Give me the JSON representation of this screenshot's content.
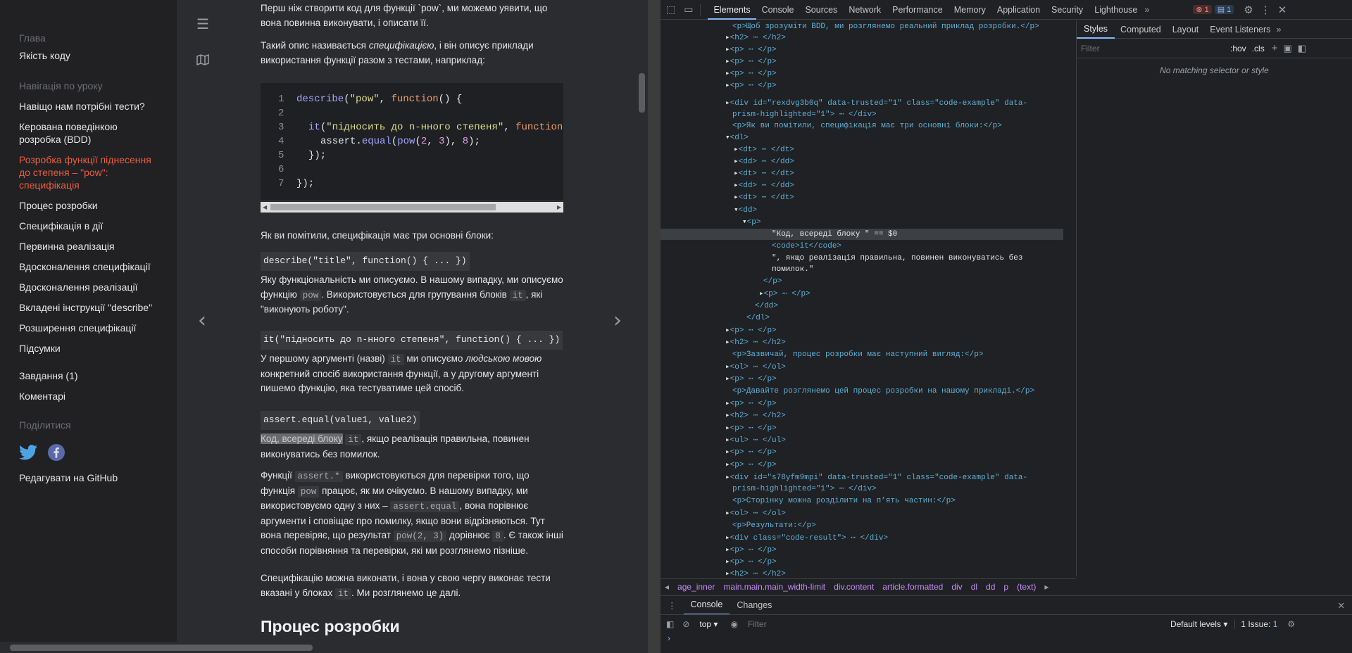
{
  "sidebar": {
    "chapter_head": "Глава",
    "chapter_link": "Якість коду",
    "nav_head": "Навігація по уроку",
    "nav_items": [
      "Навіщо нам потрібні тести?",
      "Керована поведінкою розробка (BDD)",
      "Розробка функції піднесення до степеня – \"pow\": специфікація",
      "Процес розробки",
      "Специфікація в дії",
      "Первинна реалізація",
      "Вдосконалення специфікації",
      "Вдосконалення реалізації",
      "Вкладені інструкції \"describe\"",
      "Розширення специфікації",
      "Підсумки"
    ],
    "tasks": "Завдання (1)",
    "comments": "Коментарі",
    "share_head": "Поділитися",
    "edit": "Редагувати на GitHub"
  },
  "content": {
    "p1": "Перш ніж створити код для функції `pow`, ми можемо уявити, що вона повинна виконувати, і описати її.",
    "p2a": "Такий опис називається ",
    "p2b": "специфікацією",
    "p2c": ", і він описує приклади використання функції разом з тестами, наприклад:",
    "code_lines": [
      "1",
      "2",
      "3",
      "4",
      "5",
      "6",
      "7"
    ],
    "code_l1a": "describe",
    "code_l1b": "(",
    "code_l1c": "\"pow\"",
    "code_l1d": ", ",
    "code_l1e": "function",
    "code_l1f": "() {",
    "code_l3a": "it",
    "code_l3b": "(",
    "code_l3c": "\"підносить до n-нного степеня\"",
    "code_l3d": ", ",
    "code_l3e": "function(",
    "code_l4a": "assert.",
    "code_l4b": "equal",
    "code_l4c": "(",
    "code_l4d": "pow",
    "code_l4e": "(",
    "code_l4f": "2",
    "code_l4g": ", ",
    "code_l4h": "3",
    "code_l4i": "), ",
    "code_l4j": "8",
    "code_l4k": ");",
    "code_l5": "});",
    "code_l7": "});",
    "p3": "Як ви помітили, специфікація має три основні блоки:",
    "sig1": "describe(\"title\", function() { ... })",
    "p4a": "Яку функціональність ми описуємо. В нашому випадку, ми описуємо функцію ",
    "p4b": "pow",
    "p4c": ". Використовується для групування блоків ",
    "p4d": "it",
    "p4e": ", які \"виконують роботу\".",
    "sig2": "it(\"підносить до n-нного степеня\", function() { ... })",
    "p5a": "У першому аргументі (назві) ",
    "p5b": "it",
    "p5c": " ми описуємо ",
    "p5d": "людською мовою",
    "p5e": " конкретний спосіб використання функції, а у другому аргументі пишемо функцію, яка тестуватиме цей спосіб.",
    "sig3": "assert.equal(value1, value2)",
    "p6a": "Код, всереді блоку",
    "p6b": "it",
    "p6c": ", якщо реалізація правильна, повинен виконуватись без помилок.",
    "p7a": "Функції ",
    "p7b": "assert.*",
    "p7c": " використовуються для перевірки того, що функція ",
    "p7d": "pow",
    "p7e": " працює, як ми очікуємо. В нашому випадку, ми використовуємо одну з них – ",
    "p7f": "assert.equal",
    "p7g": ", вона порівнює аргументи і сповіщає про помилку, якщо вони відрізняються. Тут вона перевіряє, що результат ",
    "p7h": "pow(2, 3)",
    "p7i": " дорівнює ",
    "p7j": "8",
    "p7k": ". Є також інші способи порівняння та перевірки, які ми розглянемо пізніше.",
    "p8a": "Специфікацію можна виконати, і вона у свою чергу виконає тести вказані у блоках ",
    "p8b": "it",
    "p8c": ". Ми розглянемо це далі.",
    "h2": "Процес розробки"
  },
  "devtools": {
    "tabs": [
      "Elements",
      "Console",
      "Sources",
      "Network",
      "Performance",
      "Memory",
      "Application",
      "Security",
      "Lighthouse"
    ],
    "errors": "1",
    "messages": "1",
    "styles_tabs": [
      "Styles",
      "Computed",
      "Layout",
      "Event Listeners"
    ],
    "filter_placeholder": "Filter",
    "hov": ":hov",
    "cls": ".cls",
    "no_match": "No matching selector or style",
    "breadcrumbs": [
      "age_inner",
      "main.main.main_width-limit",
      "div.content",
      "article.formatted",
      "div",
      "dl",
      "dd",
      "p",
      "(text)"
    ],
    "console_tabs": [
      "Console",
      "Changes"
    ],
    "context": "top",
    "levels": "Default levels",
    "issues": "1 Issue:",
    "issues_count": "1",
    "tree": [
      "<p>Щоб зрозуміти BDD, ми розглянемо реальний приклад розробки.</p>",
      "<h2> ⋯ </h2>",
      "<p> ⋯ </p>",
      "<p> ⋯ </p>",
      "<p> ⋯ </p>",
      "<p> ⋯ </p>",
      "<div id=\"rexdvg3b0q\" data-trusted=\"1\" class=\"code-example\" data-",
      "prism-highlighted=\"1\"> ⋯ </div>",
      "<p>Як ви помітили, специфікація має три основні блоки:</p>",
      "<dl>",
      "<dt> ⋯ </dt>",
      "<dd> ⋯ </dd>",
      "<dt> ⋯ </dt>",
      "<dd> ⋯ </dd>",
      "<dt> ⋯ </dt>",
      "<dd>",
      "<p>",
      "\"Код, всереді блоку \" == $0",
      "<code>it</code>",
      "\", якщо реалізація правильна, повинен виконуватись без",
      "помилок.\"",
      "</p>",
      "<p> ⋯ </p>",
      "</dd>",
      "</dl>",
      "<p> ⋯ </p>",
      "<h2> ⋯ </h2>",
      "<p>Зазвичай, процес розробки має наступний вигляд:</p>",
      "<ol> ⋯ </ol>",
      "<p> ⋯ </p>",
      "<p>Давайте розглянемо цей процес розробки на нашому прикладі.</p>",
      "<p> ⋯ </p>",
      "<h2> ⋯ </h2>",
      "<p> ⋯ </p>",
      "<ul> ⋯ </ul>",
      "<p> ⋯ </p>",
      "<p> ⋯ </p>",
      "<div id=\"s78yfm9mpi\" data-trusted=\"1\" class=\"code-example\" data-",
      "prism-highlighted=\"1\"> ⋯ </div>",
      "<p>Сторінку можна розділити на п’ять частин:</p>",
      "<ol> ⋯ </ol>",
      "<p>Результати:</p>",
      "<div class=\"code-result\"> ⋯ </div>",
      "<p> ⋯ </p>",
      "<p> ⋯ </p>",
      "<h2> ⋯ </h2>"
    ]
  },
  "colors": {
    "accent": "#ea5c40",
    "dt_accent": "#8ab4f8"
  }
}
